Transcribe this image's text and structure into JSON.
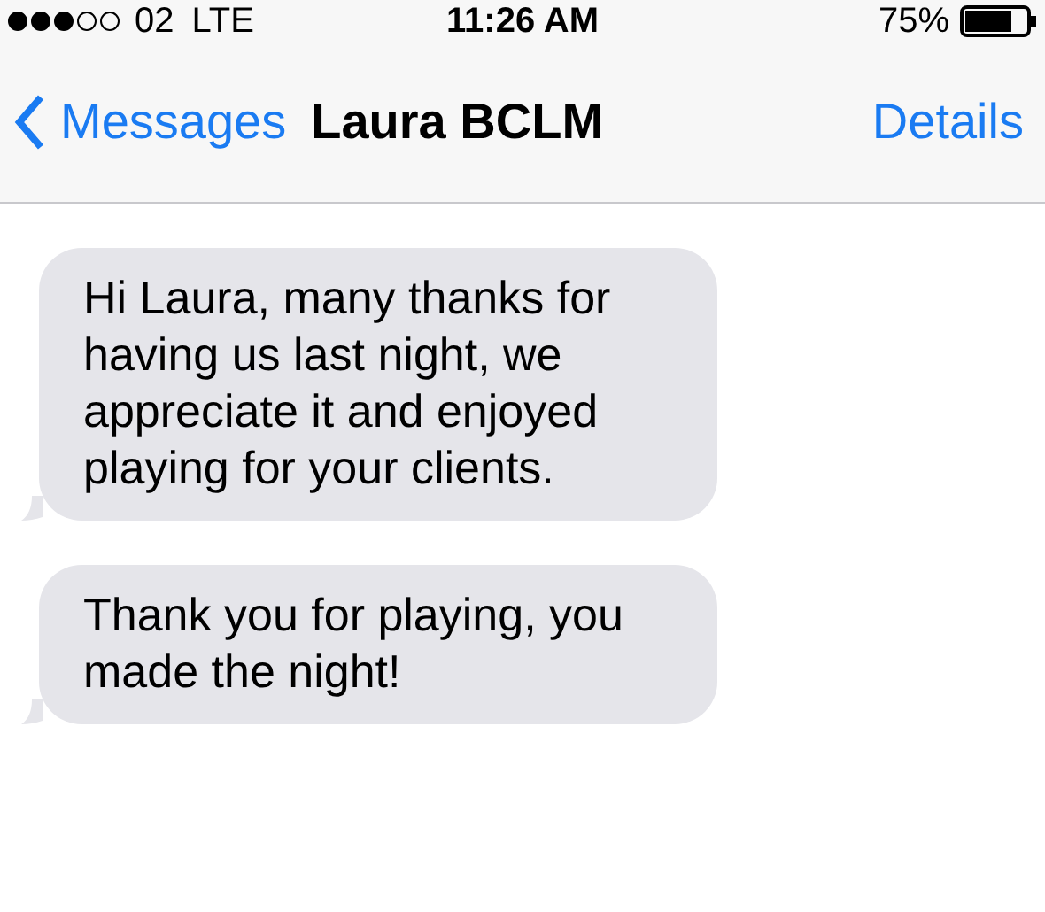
{
  "status_bar": {
    "carrier": "02",
    "network": "LTE",
    "time": "11:26 AM",
    "battery": "75%"
  },
  "nav_bar": {
    "back": "Messages",
    "title": "Laura BCLM",
    "action": "Details"
  },
  "messages": [
    {
      "kind": "incoming",
      "text": "Hi Laura, many thanks for having us last night, we appreciate it and enjoyed playing for your clients."
    },
    {
      "kind": "incoming",
      "text": "Thank you for playing, you made the night!"
    }
  ]
}
